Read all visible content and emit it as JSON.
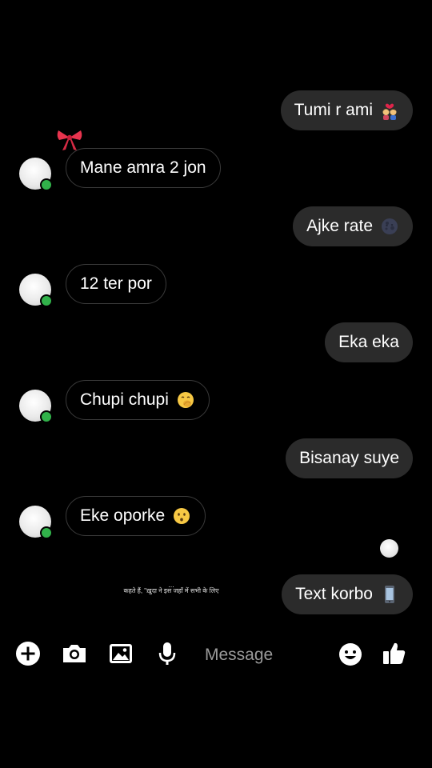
{
  "messages": [
    {
      "side": "out",
      "text": "Tumi r ami",
      "emoji": "couple-with-heart-emoji"
    },
    {
      "side": "in",
      "text": "Mane amra 2 jon",
      "emoji": ""
    },
    {
      "side": "out",
      "text": "Ajke rate",
      "emoji": "new-moon-face-emoji"
    },
    {
      "side": "in",
      "text": "12 ter por",
      "emoji": ""
    },
    {
      "side": "out",
      "text": "Eka eka",
      "emoji": ""
    },
    {
      "side": "in",
      "text": "Chupi chupi",
      "emoji": "face-with-hand-over-mouth-emoji"
    },
    {
      "side": "out",
      "text": "Bisanay suye",
      "emoji": ""
    },
    {
      "side": "in",
      "text": "Eke oporke",
      "emoji": "hushed-face-emoji"
    },
    {
      "side": "out",
      "text": "Text korbo",
      "emoji": "mobile-phone-emoji"
    }
  ],
  "watermark": {
    "dots": "...",
    "text": "कहते हैं, \"ख़ुदा ने इस जहाँ में सभी के लिए"
  },
  "composer": {
    "placeholder": "Message",
    "icons": [
      "plus-icon",
      "camera-icon",
      "gallery-icon",
      "microphone-icon",
      "emoji-icon",
      "thumbs-up-icon"
    ]
  },
  "colors": {
    "background": "#000000",
    "outgoing_bubble": "#2b2b2b",
    "incoming_border": "#3a3a3a",
    "online_dot": "#31b24a",
    "text": "#ffffff",
    "placeholder": "#9a9a9a"
  }
}
